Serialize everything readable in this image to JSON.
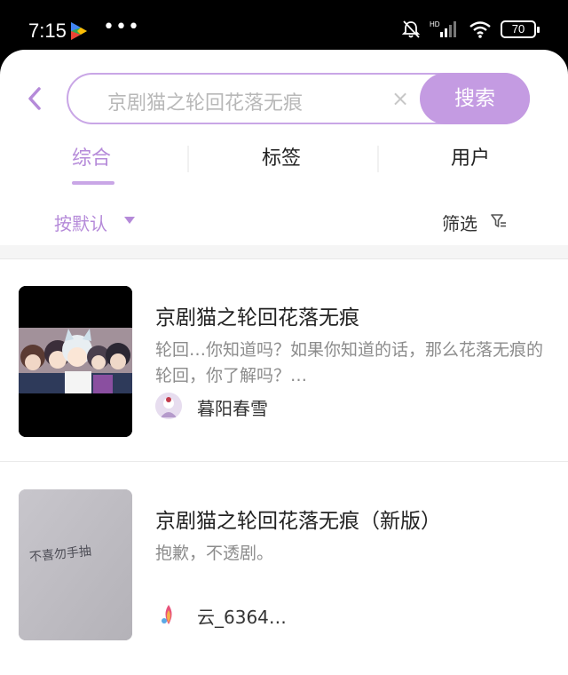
{
  "status": {
    "time": "7:15",
    "more": "•••",
    "battery": "70",
    "signal_label": "HD"
  },
  "search": {
    "query": "京剧猫之轮回花落无痕",
    "clear_label": "×",
    "button_label": "搜索"
  },
  "tabs": [
    {
      "label": "综合",
      "active": true
    },
    {
      "label": "标签",
      "active": false
    },
    {
      "label": "用户",
      "active": false
    }
  ],
  "filters": {
    "sort_label": "按默认",
    "filter_label": "筛选"
  },
  "results": [
    {
      "title": "京剧猫之轮回花落无痕",
      "description": "轮回…你知道吗？如果你知道的话，那么花落无痕的轮回，你了解吗？…",
      "author": "暮阳春雪"
    },
    {
      "title": "京剧猫之轮回花落无痕（新版）",
      "description": "抱歉，不透剧。",
      "author": "云_6364…",
      "cover_text": "不喜勿手抽"
    }
  ],
  "colors": {
    "accent": "#c49be2",
    "accent_text": "#b58ad9",
    "border": "#c9a6e6"
  }
}
